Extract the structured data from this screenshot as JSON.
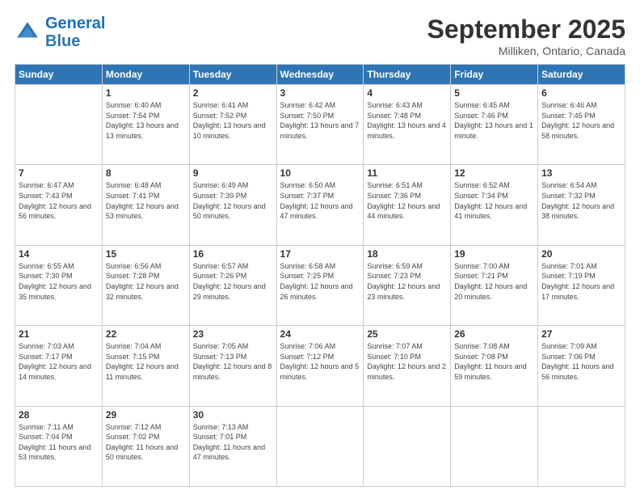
{
  "header": {
    "logo_line1": "General",
    "logo_line2": "Blue",
    "month": "September 2025",
    "location": "Milliken, Ontario, Canada"
  },
  "weekdays": [
    "Sunday",
    "Monday",
    "Tuesday",
    "Wednesday",
    "Thursday",
    "Friday",
    "Saturday"
  ],
  "weeks": [
    [
      {
        "day": "",
        "info": ""
      },
      {
        "day": "1",
        "info": "Sunrise: 6:40 AM\nSunset: 7:54 PM\nDaylight: 13 hours\nand 13 minutes."
      },
      {
        "day": "2",
        "info": "Sunrise: 6:41 AM\nSunset: 7:52 PM\nDaylight: 13 hours\nand 10 minutes."
      },
      {
        "day": "3",
        "info": "Sunrise: 6:42 AM\nSunset: 7:50 PM\nDaylight: 13 hours\nand 7 minutes."
      },
      {
        "day": "4",
        "info": "Sunrise: 6:43 AM\nSunset: 7:48 PM\nDaylight: 13 hours\nand 4 minutes."
      },
      {
        "day": "5",
        "info": "Sunrise: 6:45 AM\nSunset: 7:46 PM\nDaylight: 13 hours\nand 1 minute."
      },
      {
        "day": "6",
        "info": "Sunrise: 6:46 AM\nSunset: 7:45 PM\nDaylight: 12 hours\nand 58 minutes."
      }
    ],
    [
      {
        "day": "7",
        "info": "Sunrise: 6:47 AM\nSunset: 7:43 PM\nDaylight: 12 hours\nand 56 minutes."
      },
      {
        "day": "8",
        "info": "Sunrise: 6:48 AM\nSunset: 7:41 PM\nDaylight: 12 hours\nand 53 minutes."
      },
      {
        "day": "9",
        "info": "Sunrise: 6:49 AM\nSunset: 7:39 PM\nDaylight: 12 hours\nand 50 minutes."
      },
      {
        "day": "10",
        "info": "Sunrise: 6:50 AM\nSunset: 7:37 PM\nDaylight: 12 hours\nand 47 minutes."
      },
      {
        "day": "11",
        "info": "Sunrise: 6:51 AM\nSunset: 7:36 PM\nDaylight: 12 hours\nand 44 minutes."
      },
      {
        "day": "12",
        "info": "Sunrise: 6:52 AM\nSunset: 7:34 PM\nDaylight: 12 hours\nand 41 minutes."
      },
      {
        "day": "13",
        "info": "Sunrise: 6:54 AM\nSunset: 7:32 PM\nDaylight: 12 hours\nand 38 minutes."
      }
    ],
    [
      {
        "day": "14",
        "info": "Sunrise: 6:55 AM\nSunset: 7:30 PM\nDaylight: 12 hours\nand 35 minutes."
      },
      {
        "day": "15",
        "info": "Sunrise: 6:56 AM\nSunset: 7:28 PM\nDaylight: 12 hours\nand 32 minutes."
      },
      {
        "day": "16",
        "info": "Sunrise: 6:57 AM\nSunset: 7:26 PM\nDaylight: 12 hours\nand 29 minutes."
      },
      {
        "day": "17",
        "info": "Sunrise: 6:58 AM\nSunset: 7:25 PM\nDaylight: 12 hours\nand 26 minutes."
      },
      {
        "day": "18",
        "info": "Sunrise: 6:59 AM\nSunset: 7:23 PM\nDaylight: 12 hours\nand 23 minutes."
      },
      {
        "day": "19",
        "info": "Sunrise: 7:00 AM\nSunset: 7:21 PM\nDaylight: 12 hours\nand 20 minutes."
      },
      {
        "day": "20",
        "info": "Sunrise: 7:01 AM\nSunset: 7:19 PM\nDaylight: 12 hours\nand 17 minutes."
      }
    ],
    [
      {
        "day": "21",
        "info": "Sunrise: 7:03 AM\nSunset: 7:17 PM\nDaylight: 12 hours\nand 14 minutes."
      },
      {
        "day": "22",
        "info": "Sunrise: 7:04 AM\nSunset: 7:15 PM\nDaylight: 12 hours\nand 11 minutes."
      },
      {
        "day": "23",
        "info": "Sunrise: 7:05 AM\nSunset: 7:13 PM\nDaylight: 12 hours\nand 8 minutes."
      },
      {
        "day": "24",
        "info": "Sunrise: 7:06 AM\nSunset: 7:12 PM\nDaylight: 12 hours\nand 5 minutes."
      },
      {
        "day": "25",
        "info": "Sunrise: 7:07 AM\nSunset: 7:10 PM\nDaylight: 12 hours\nand 2 minutes."
      },
      {
        "day": "26",
        "info": "Sunrise: 7:08 AM\nSunset: 7:08 PM\nDaylight: 11 hours\nand 59 minutes."
      },
      {
        "day": "27",
        "info": "Sunrise: 7:09 AM\nSunset: 7:06 PM\nDaylight: 11 hours\nand 56 minutes."
      }
    ],
    [
      {
        "day": "28",
        "info": "Sunrise: 7:11 AM\nSunset: 7:04 PM\nDaylight: 11 hours\nand 53 minutes."
      },
      {
        "day": "29",
        "info": "Sunrise: 7:12 AM\nSunset: 7:02 PM\nDaylight: 11 hours\nand 50 minutes."
      },
      {
        "day": "30",
        "info": "Sunrise: 7:13 AM\nSunset: 7:01 PM\nDaylight: 11 hours\nand 47 minutes."
      },
      {
        "day": "",
        "info": ""
      },
      {
        "day": "",
        "info": ""
      },
      {
        "day": "",
        "info": ""
      },
      {
        "day": "",
        "info": ""
      }
    ]
  ]
}
